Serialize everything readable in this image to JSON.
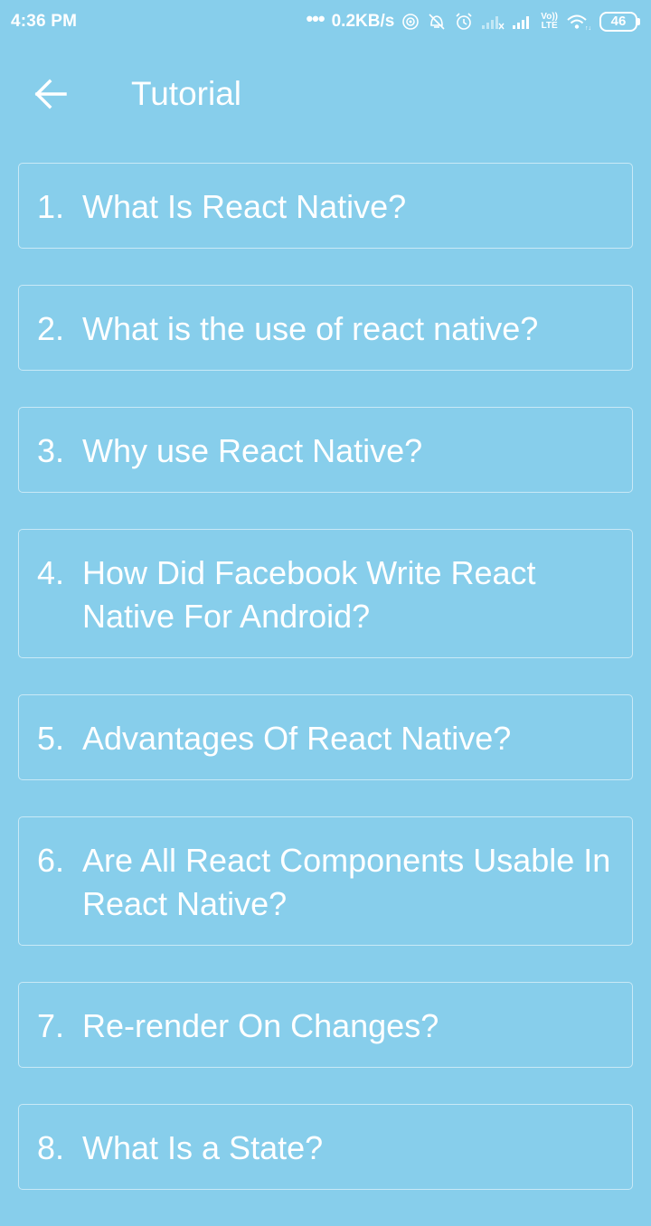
{
  "status_bar": {
    "time": "4:36 PM",
    "dots": "•••",
    "speed": "0.2KB/s",
    "volte_top": "Vo))",
    "volte_bottom": "LTE",
    "battery": "46"
  },
  "header": {
    "title": "Tutorial"
  },
  "items": [
    {
      "num": "1.",
      "text": "What Is React Native?"
    },
    {
      "num": "2.",
      "text": "What is the use of react native?"
    },
    {
      "num": "3.",
      "text": "Why use React Native?"
    },
    {
      "num": "4.",
      "text": "How Did Facebook Write React Native For Android?"
    },
    {
      "num": "5.",
      "text": "Advantages Of React Native?"
    },
    {
      "num": "6.",
      "text": "Are All React Components Usable In React Native?"
    },
    {
      "num": "7.",
      "text": "Re-render On Changes?"
    },
    {
      "num": "8.",
      "text": "What Is a State?"
    }
  ],
  "colors": {
    "background": "#87CEEB",
    "text": "#FFFFFF",
    "border": "#D6EEF8"
  },
  "icons": {
    "back": "arrow-left-icon",
    "hotspot": "hotspot-icon",
    "alarm_off": "alarm-off-icon",
    "alarm": "alarm-clock-icon",
    "signal1": "signal-weak-icon",
    "signal2": "signal-strong-icon",
    "wifi": "wifi-icon"
  }
}
